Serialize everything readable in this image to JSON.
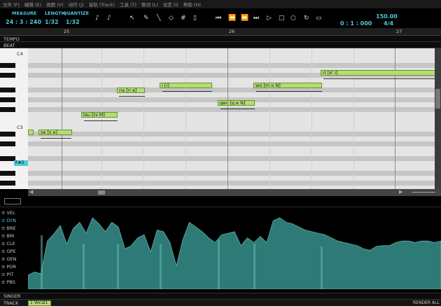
{
  "menu": [
    "文件 (F)",
    "编辑 (E)",
    "视图 (V)",
    "动作 (J)",
    "音轨 (Track)",
    "工具 (T)",
    "歌词 (L)",
    "设定 (I)",
    "帮助 (H)"
  ],
  "toolbar": {
    "measure_label": "MEASURE",
    "length_label": "LENGTH",
    "quantize_label": "QUANTIZE",
    "position": "24 : 3 : 240",
    "length_value": "1/32",
    "quantize_value": "1/32",
    "time": "0 : 1 : 000",
    "tempo": "150.00",
    "timesig": "4/4"
  },
  "ruler": {
    "bar1": "25",
    "bar2": "26",
    "bar3": "27"
  },
  "rows": {
    "tempo": "TEMPO",
    "beat": "BEAT"
  },
  "keyboard": {
    "c4": "C4",
    "c3": "C3",
    "current": "F#3"
  },
  "notes": [
    {
      "lyric": "",
      "phonetic": ""
    },
    {
      "lyric": "se",
      "phonetic": "[s e]"
    },
    {
      "lyric": "tsu",
      "phonetic": "[ts M]"
    },
    {
      "lyric": "na",
      "phonetic": "[n a]"
    },
    {
      "lyric": "i",
      "phonetic": "[i]"
    },
    {
      "lyric": "gen",
      "phonetic": "[g e N]"
    },
    {
      "lyric": "wo",
      "phonetic": "[m o N]"
    },
    {
      "lyric": "ri",
      "phonetic": "[4' i]"
    }
  ],
  "controls": [
    "VEL",
    "DYN",
    "BRE",
    "BRI",
    "CLE",
    "OPE",
    "GEN",
    "POR",
    "PIT",
    "PBS"
  ],
  "controls_active": "DYN",
  "dyn_curve": [
    0.18,
    0.22,
    0.2,
    0.62,
    0.71,
    0.82,
    0.58,
    0.78,
    0.86,
    0.72,
    0.92,
    0.84,
    0.74,
    0.86,
    0.8,
    0.52,
    0.56,
    0.66,
    0.7,
    0.48,
    0.76,
    0.74,
    0.6,
    0.3,
    0.64,
    0.86,
    0.8,
    0.74,
    0.66,
    0.6,
    0.7,
    0.72,
    0.74,
    0.56,
    0.66,
    0.6,
    0.68,
    0.6,
    0.88,
    0.92,
    0.86,
    0.84,
    0.8,
    0.76,
    0.74,
    0.72,
    0.7,
    0.66,
    0.62,
    0.6,
    0.58,
    0.56,
    0.52,
    0.5,
    0.55,
    0.56,
    0.56,
    0.6,
    0.62,
    0.62,
    0.6,
    0.62,
    0.62,
    0.6,
    0.62
  ],
  "bottom": {
    "singer": "SINGER",
    "track": "TRACK",
    "track_name": "1 Vocal1",
    "render": "RENDER ALL"
  },
  "colors": {
    "accent": "#4ec9d9",
    "note": "#b3de6f",
    "dynamics": "#2e7a76"
  }
}
